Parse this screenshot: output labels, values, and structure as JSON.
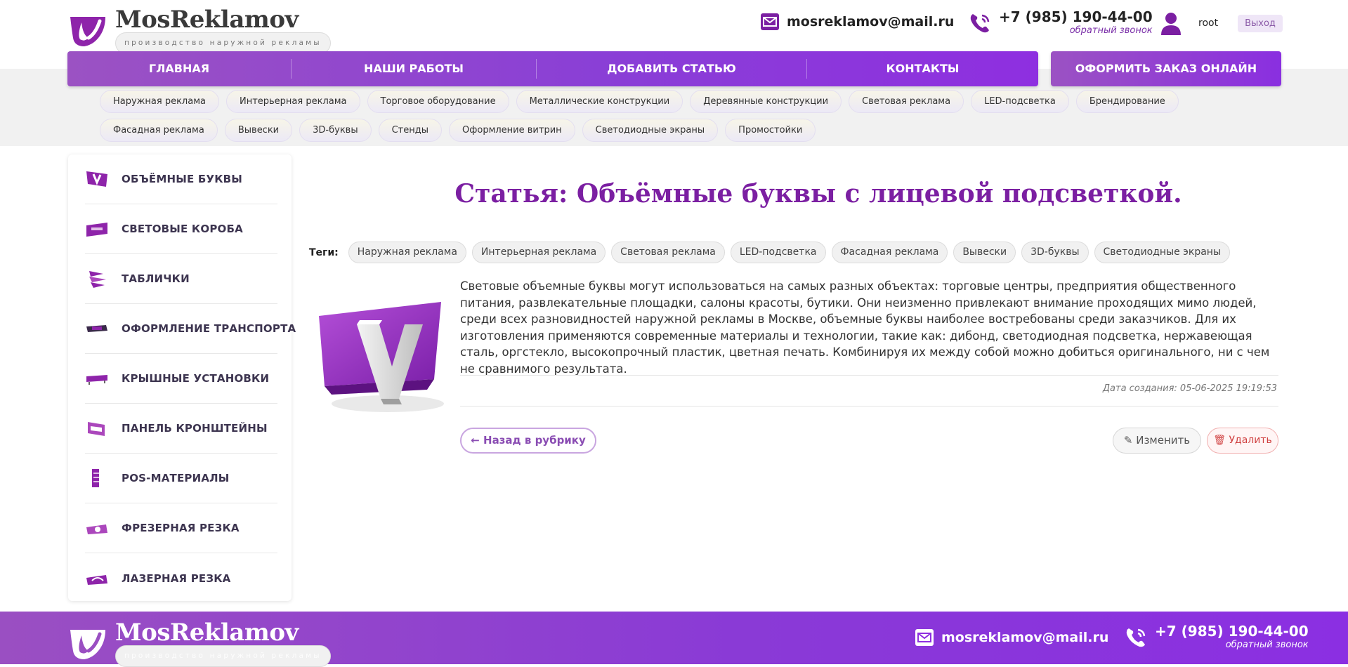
{
  "brand": {
    "name": "MosReklamov",
    "tagline": "производство наружной рекламы",
    "color": "#7b1fa2"
  },
  "header": {
    "email": "mosreklamov@mail.ru",
    "phone": "+7 (985) 190-44-00",
    "callback": "обратный звонок",
    "user": "root",
    "logout": "Выход"
  },
  "nav": {
    "items": [
      "ГЛАВНАЯ",
      "НАШИ РАБОТЫ",
      "ДОБАВИТЬ СТАТЬЮ",
      "КОНТАКТЫ"
    ],
    "order": "ОФОРМИТЬ ЗАКАЗ ОНЛАЙН"
  },
  "categories": [
    "Наружная реклама",
    "Интерьерная реклама",
    "Торговое оборудование",
    "Металлические конструкции",
    "Деревянные конструкции",
    "Световая реклама",
    "LED-подсветка",
    "Брендирование",
    "Фасадная реклама",
    "Вывески",
    "3D-буквы",
    "Стенды",
    "Оформление витрин",
    "Светодиодные экраны",
    "Промостойки"
  ],
  "sidebar": {
    "items": [
      {
        "label": "ОБЪЁМНЫЕ БУКВЫ",
        "icon": "volume-letters-icon"
      },
      {
        "label": "СВЕТОВЫЕ КОРОБА",
        "icon": "light-box-icon"
      },
      {
        "label": "ТАБЛИЧКИ",
        "icon": "signs-icon"
      },
      {
        "label": "ОФОРМЛЕНИЕ ТРАНСПОРТА",
        "icon": "vehicle-wrap-icon"
      },
      {
        "label": "КРЫШНЫЕ УСТАНОВКИ",
        "icon": "roof-install-icon"
      },
      {
        "label": "ПАНЕЛЬ КРОНШТЕЙНЫ",
        "icon": "bracket-panel-icon"
      },
      {
        "label": "POS-МАТЕРИАЛЫ",
        "icon": "pos-materials-icon"
      },
      {
        "label": "ФРЕЗЕРНАЯ РЕЗКА",
        "icon": "milling-cut-icon"
      },
      {
        "label": "ЛАЗЕРНАЯ РЕЗКА",
        "icon": "laser-cut-icon"
      }
    ]
  },
  "article": {
    "title": "Статья: Объёмные буквы с лицевой подсветкой.",
    "tags_label": "Теги:",
    "tags": [
      "Наружная реклама",
      "Интерьерная реклама",
      "Световая реклама",
      "LED-подсветка",
      "Фасадная реклама",
      "Вывески",
      "3D-буквы",
      "Светодиодные экраны"
    ],
    "body": "Световые объемные буквы могут использоваться на самых разных объектах: торговые центры, предприятия общественного питания, развлекательные площадки, салоны красоты, бутики. Они неизменно привлекают внимание проходящих мимо людей, среди всех разновидностей наружной рекламы в Москве, объемные буквы наиболее востребованы среди заказчиков. Для их изготовления применяются современные материалы и технологии, такие как: дибонд, светодиодная подсветка, нержавеющая сталь, оргстекло, высокопрочный пластик, цветная печать. Комбинируя их между собой можно добиться оригинального, ни с чем не сравнимого результата.",
    "date": "Дата создания: 05-06-2025 19:19:53",
    "back": "← Назад в рубрику",
    "edit": "✎ Изменить",
    "delete": "🗑 Удалить"
  },
  "footer": {
    "email": "mosreklamov@mail.ru",
    "phone": "+7 (985) 190-44-00",
    "callback": "обратный звонок"
  }
}
